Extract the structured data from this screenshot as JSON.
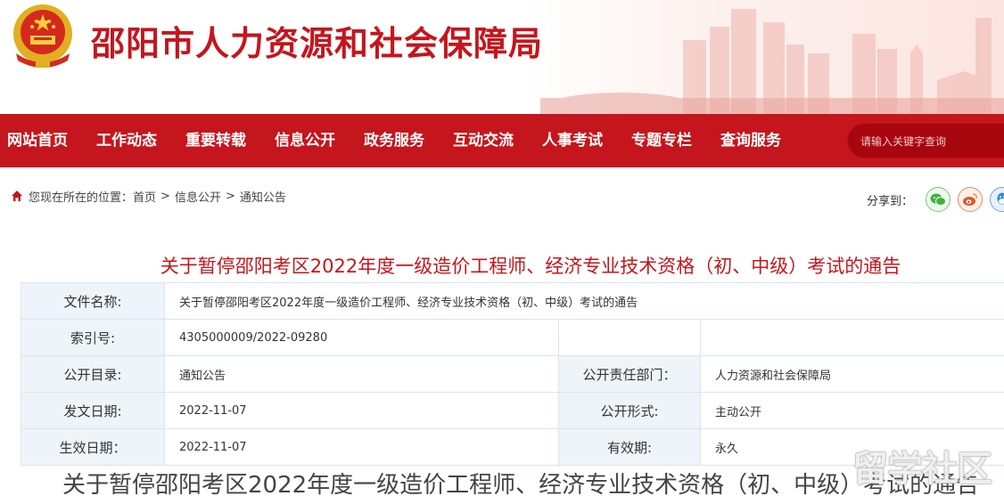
{
  "header": {
    "site_title": "邵阳市人力资源和社会保障局",
    "emblem_icon": "national-emblem-icon",
    "brand_color": "#c4161c"
  },
  "nav": {
    "items": [
      {
        "label": "网站首页"
      },
      {
        "label": "工作动态"
      },
      {
        "label": "重要转载"
      },
      {
        "label": "信息公开"
      },
      {
        "label": "政务服务"
      },
      {
        "label": "互动交流"
      },
      {
        "label": "人事考试"
      },
      {
        "label": "专题专栏"
      },
      {
        "label": "查询服务"
      }
    ],
    "search_placeholder": "请输入关键字查询"
  },
  "breadcrumb": {
    "prefix": "您现在所在的位置：",
    "items": [
      "首页",
      "信息公开",
      "通知公告"
    ],
    "separator": ">"
  },
  "share": {
    "label": "分享到：",
    "icons": [
      "wechat-icon",
      "weibo-icon",
      "qq-icon"
    ]
  },
  "article": {
    "title": "关于暂停邵阳考区2022年度一级造价工程师、经济专业技术资格（初、中级）考试的通告"
  },
  "meta": {
    "file_name_label": "文件名称:",
    "file_name_value": "关于暂停邵阳考区2022年度一级造价工程师、经济专业技术资格（初、中级）考试的通告",
    "index_label": "索引号:",
    "index_value": "4305000009/2022-09280",
    "catalog_label": "公开目录:",
    "catalog_value": "通知公告",
    "dept_label": "公开责任部门：",
    "dept_value": "人力资源和社会保障局",
    "issue_date_label": "发文日期:",
    "issue_date_value": "2022-11-07",
    "form_label": "公开形式:",
    "form_value": "主动公开",
    "effective_date_label": "生效日期：",
    "effective_date_value": "2022-11-07",
    "validity_label": "有效期:",
    "validity_value": "永久"
  },
  "caption": {
    "text": "关于暂停邵阳考区2022年度一级造价工程师、经济专业技术资格（初、中级）考试的通告"
  },
  "watermark": {
    "text": "留学社区"
  }
}
